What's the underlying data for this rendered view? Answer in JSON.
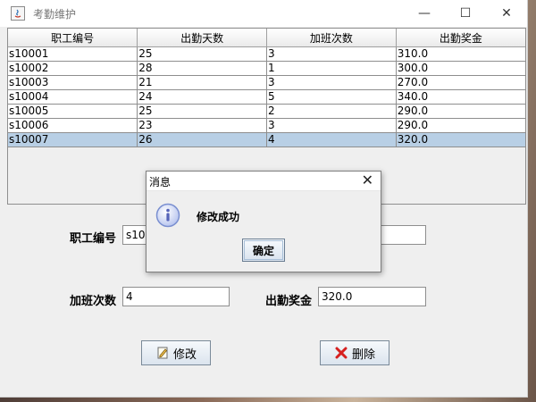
{
  "window": {
    "title": "考勤维护",
    "controls": {
      "minimize": "—",
      "maximize": "☐",
      "close": "✕"
    }
  },
  "table": {
    "columns": [
      "职工编号",
      "出勤天数",
      "加班次数",
      "出勤奖金"
    ],
    "rows": [
      [
        "s10001",
        "25",
        "3",
        "310.0"
      ],
      [
        "s10002",
        "28",
        "1",
        "300.0"
      ],
      [
        "s10003",
        "21",
        "3",
        "270.0"
      ],
      [
        "s10004",
        "24",
        "5",
        "340.0"
      ],
      [
        "s10005",
        "25",
        "2",
        "290.0"
      ],
      [
        "s10006",
        "23",
        "3",
        "290.0"
      ],
      [
        "s10007",
        "26",
        "4",
        "320.0"
      ]
    ],
    "selected_row_index": 6
  },
  "form": {
    "employee_id_label": "职工编号",
    "employee_id_value": "s10",
    "overtime_label": "加班次数",
    "overtime_value": "4",
    "bonus_label": "出勤奖金",
    "bonus_value": "320.0"
  },
  "buttons": {
    "modify_label": "修改",
    "delete_label": "删除"
  },
  "dialog": {
    "title": "消息",
    "message": "修改成功",
    "ok_label": "确定",
    "close_glyph": "✕"
  },
  "colors": {
    "selected_row": "#b8cfe5",
    "info_icon": "#7a8fd0",
    "delete_icon": "#d62020"
  }
}
